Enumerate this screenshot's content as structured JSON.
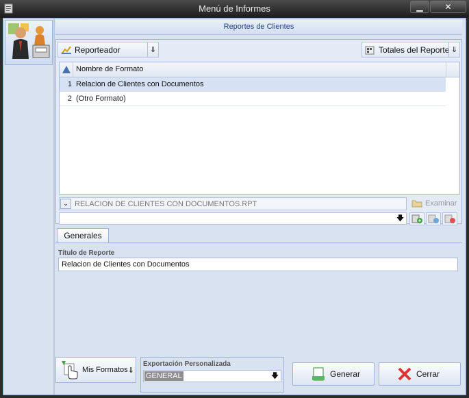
{
  "window": {
    "title": "Menú de Informes",
    "minimize_icon": "minimize-icon",
    "close_icon": "close-icon"
  },
  "header": {
    "title": "Reportes de Clientes"
  },
  "toolbar": {
    "reporteador_label": "Reporteador",
    "totales_label": "Totales del Reporte"
  },
  "grid": {
    "column_header": "Nombre de Formato",
    "rows": [
      {
        "num": "1",
        "name": "Relacion de Clientes con Documentos"
      },
      {
        "num": "2",
        "name": "(Otro Formato)"
      }
    ]
  },
  "file": {
    "path": "RELACION DE CLIENTES CON DOCUMENTOS.RPT",
    "examinar_label": "Examinar"
  },
  "tabs": {
    "generales": "Generales"
  },
  "report_title": {
    "label": "Título de Reporte",
    "value": "Relacion de Clientes con Documentos"
  },
  "bottom": {
    "mis_formatos_label": "Mis Formatos",
    "export_label": "Exportación Personalizada",
    "export_value": "GENERAL",
    "generar_label": "Generar",
    "cerrar_label": "Cerrar"
  },
  "colors": {
    "selected_row": "#d6e1f3",
    "header_text": "#1f3f7a",
    "panel": "#d8e2f1"
  }
}
